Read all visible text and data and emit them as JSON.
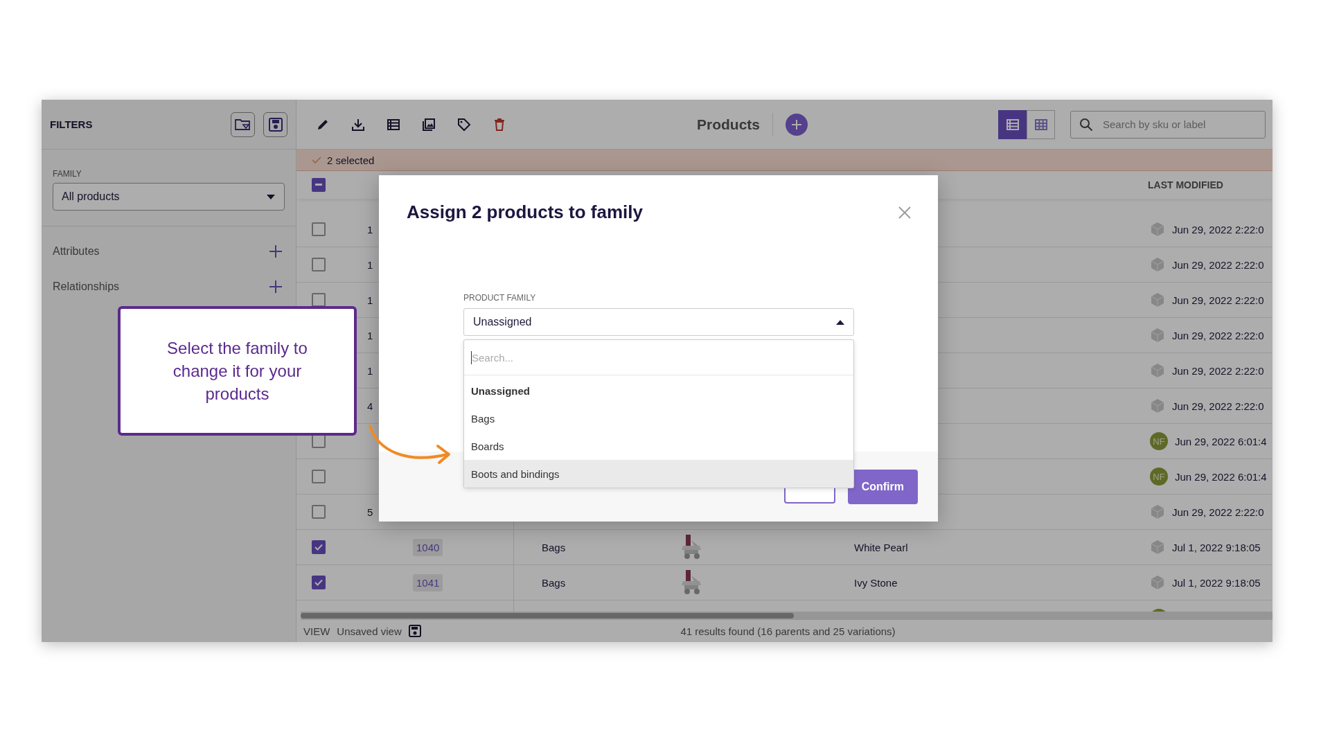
{
  "sidebar": {
    "title": "FILTERS",
    "family_label": "FAMILY",
    "family_value": "All products",
    "sections": [
      {
        "label": "Attributes"
      },
      {
        "label": "Relationships"
      }
    ]
  },
  "toolbar": {
    "title": "Products",
    "views": [
      {
        "kind": "list",
        "selected": true
      },
      {
        "kind": "grid",
        "selected": false
      }
    ],
    "search": {
      "placeholder": "Search by sku or label"
    }
  },
  "selection_bar": {
    "text": "2 selected"
  },
  "table": {
    "header_checkbox": {
      "indeterminate": true
    },
    "columns": [
      {
        "label": "LAST MODIFIED"
      }
    ],
    "rows": [
      {
        "kind": "covered",
        "checked": false,
        "id": "1",
        "modifier": {
          "kind": "system"
        },
        "modified": "Jun 29, 2022 2:22:0"
      },
      {
        "kind": "covered",
        "checked": false,
        "id": "1",
        "modifier": {
          "kind": "system"
        },
        "modified": "Jun 29, 2022 2:22:0"
      },
      {
        "kind": "covered",
        "checked": false,
        "id": "1",
        "modifier": {
          "kind": "system"
        },
        "modified": "Jun 29, 2022 2:22:0"
      },
      {
        "kind": "covered",
        "id": "1",
        "modifier": {
          "kind": "system"
        },
        "modified": "Jun 29, 2022 2:22:0"
      },
      {
        "kind": "covered",
        "id": "1",
        "modifier": {
          "kind": "system"
        },
        "modified": "Jun 29, 2022 2:22:0"
      },
      {
        "kind": "covered",
        "id": "4",
        "modifier": {
          "kind": "system"
        },
        "modified": "Jun 29, 2022 2:22:0"
      },
      {
        "kind": "covered",
        "checked": false,
        "modifier": {
          "kind": "user",
          "initials": "NF"
        },
        "modified": "Jun 29, 2022 6:01:4"
      },
      {
        "kind": "covered",
        "checked": false,
        "modifier": {
          "kind": "user",
          "initials": "NF"
        },
        "modified": "Jun 29, 2022 6:01:4"
      },
      {
        "kind": "covered",
        "checked": false,
        "id": "5",
        "modifier": {
          "kind": "system"
        },
        "modified": "Jun 29, 2022 2:22:0"
      },
      {
        "kind": "full",
        "checked": true,
        "id": "1040",
        "family": "Bags",
        "name": "White Pearl",
        "modifier": {
          "kind": "system"
        },
        "modified": "Jul 1, 2022 9:18:05"
      },
      {
        "kind": "full",
        "checked": true,
        "id": "1041",
        "family": "Bags",
        "name": "Ivy Stone",
        "modifier": {
          "kind": "system"
        },
        "modified": "Jul 1, 2022 9:18:05"
      },
      {
        "kind": "partial",
        "modifier": {
          "kind": "user"
        }
      }
    ]
  },
  "footer": {
    "view_label": "VIEW",
    "view_name": "Unsaved view",
    "results": "41 results found (16 parents and 25 variations)"
  },
  "modal": {
    "title": "Assign 2 products to family",
    "field_label": "PRODUCT FAMILY",
    "value": "Unassigned",
    "expanded": true,
    "search_placeholder": "Search...",
    "options": [
      {
        "label": "Unassigned",
        "selected": true,
        "highlighted": false
      },
      {
        "label": "Bags",
        "selected": false,
        "highlighted": false
      },
      {
        "label": "Boards",
        "selected": false,
        "highlighted": false
      },
      {
        "label": "Boots and bindings",
        "selected": false,
        "highlighted": true
      }
    ],
    "confirm": "Confirm"
  },
  "callout": {
    "text": "Select the family to change it for your products"
  }
}
